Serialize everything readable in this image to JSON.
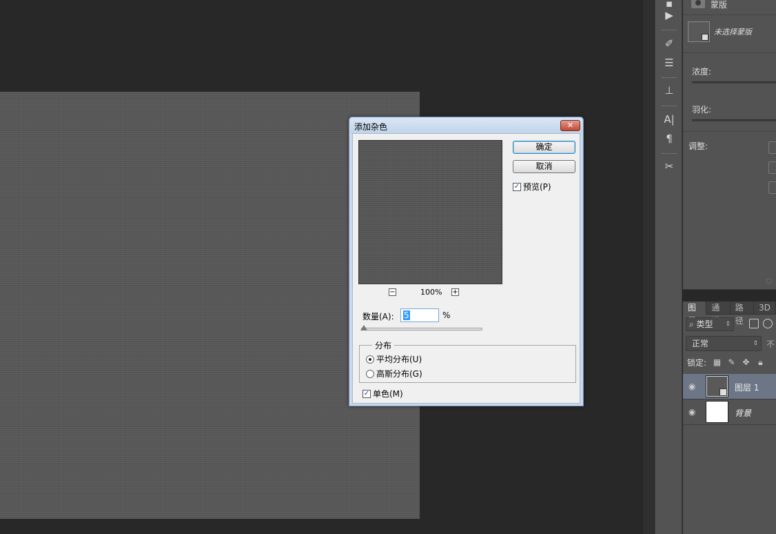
{
  "mask_panel": {
    "title": "蒙版",
    "status": "未选择蒙版",
    "density_label": "浓度:",
    "feather_label": "羽化:",
    "adjust_label": "调整:"
  },
  "tool_strip": {
    "items": [
      {
        "name": "play-icon",
        "glyph": "▶"
      },
      {
        "name": "brush-icon",
        "glyph": "✐"
      },
      {
        "name": "adjust-icon",
        "glyph": "☰"
      },
      {
        "name": "stamp-icon",
        "glyph": "⊥"
      },
      {
        "name": "character-icon",
        "glyph": "A|"
      },
      {
        "name": "paragraph-icon",
        "glyph": "¶"
      },
      {
        "name": "tools-icon",
        "glyph": "✂"
      }
    ]
  },
  "layers_panel": {
    "tabs": [
      {
        "label": "图层",
        "active": true
      },
      {
        "label": "通道",
        "active": false
      },
      {
        "label": "路径",
        "active": false
      },
      {
        "label": "3D",
        "active": false
      }
    ],
    "filter_label": "类型",
    "blend_mode": "正常",
    "opacity_label_cut": "不",
    "lock_label": "锁定:",
    "layers": [
      {
        "name": "图层 1",
        "selected": true,
        "italic": false
      },
      {
        "name": "背景",
        "selected": false,
        "italic": true
      }
    ]
  },
  "dialog": {
    "title": "添加杂色",
    "close_glyph": "✕",
    "ok_label": "确定",
    "cancel_label": "取消",
    "preview_label": "预览(P)",
    "preview_checked": true,
    "zoom_out": "−",
    "zoom_in": "+",
    "zoom_value": "100%",
    "amount_label": "数量(A):",
    "amount_value": "5",
    "amount_unit": "%",
    "amount_fraction": 0.012,
    "distribution_label": "分布",
    "uniform_label": "平均分布(U)",
    "gaussian_label": "高斯分布(G)",
    "selected_distribution": "uniform",
    "mono_label": "单色(M)",
    "mono_checked": true
  }
}
